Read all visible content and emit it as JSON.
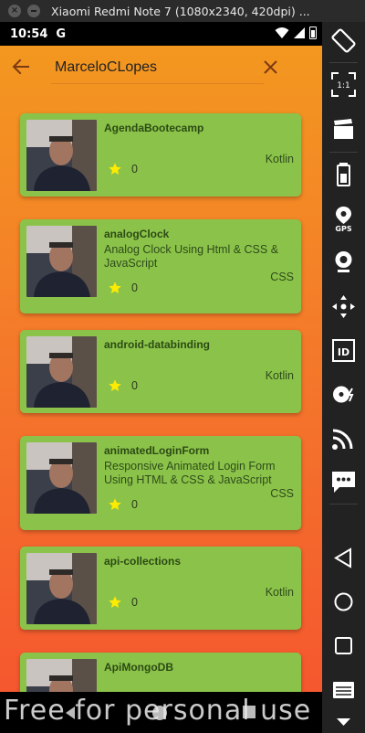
{
  "window": {
    "title": "Xiaomi Redmi Note 7 (1080x2340, 420dpi) ..."
  },
  "statusbar": {
    "time": "10:54",
    "g_icon": "G"
  },
  "search": {
    "value": "MarceloCLopes",
    "placeholder": ""
  },
  "repos": [
    {
      "name": "AgendaBootecamp",
      "description": "",
      "stars": "0",
      "language": "Kotlin"
    },
    {
      "name": "analogClock",
      "description": "Analog Clock Using Html & CSS & JavaScript",
      "stars": "0",
      "language": "CSS"
    },
    {
      "name": "android-databinding",
      "description": "",
      "stars": "0",
      "language": "Kotlin"
    },
    {
      "name": "animatedLoginForm",
      "description": "Responsive Animated Login Form Using HTML & CSS & JavaScript",
      "stars": "0",
      "language": "CSS"
    },
    {
      "name": "api-collections",
      "description": "",
      "stars": "0",
      "language": "Kotlin"
    },
    {
      "name": "ApiMongoDB",
      "description": "",
      "stars": "",
      "language": ""
    }
  ],
  "watermark": "Free for personal use",
  "colors": {
    "card": "#8bc34a",
    "gradient_top": "#f39a1f",
    "gradient_bottom": "#f5532f",
    "star": "#ffeb00"
  },
  "icons": {
    "back": "arrow-left-icon",
    "clear": "close-icon",
    "star": "star-icon",
    "sidebar": [
      "rotate-icon",
      "scale-one-to-one-icon",
      "clapperboard-icon",
      "battery-icon",
      "gps-icon",
      "webcam-icon",
      "dpad-move-icon",
      "id-card-icon",
      "disk-icon",
      "cast-icon",
      "sms-icon",
      "back-triangle-icon",
      "home-circle-icon",
      "recents-square-icon",
      "menu-icon",
      "chevron-down-icon"
    ]
  }
}
